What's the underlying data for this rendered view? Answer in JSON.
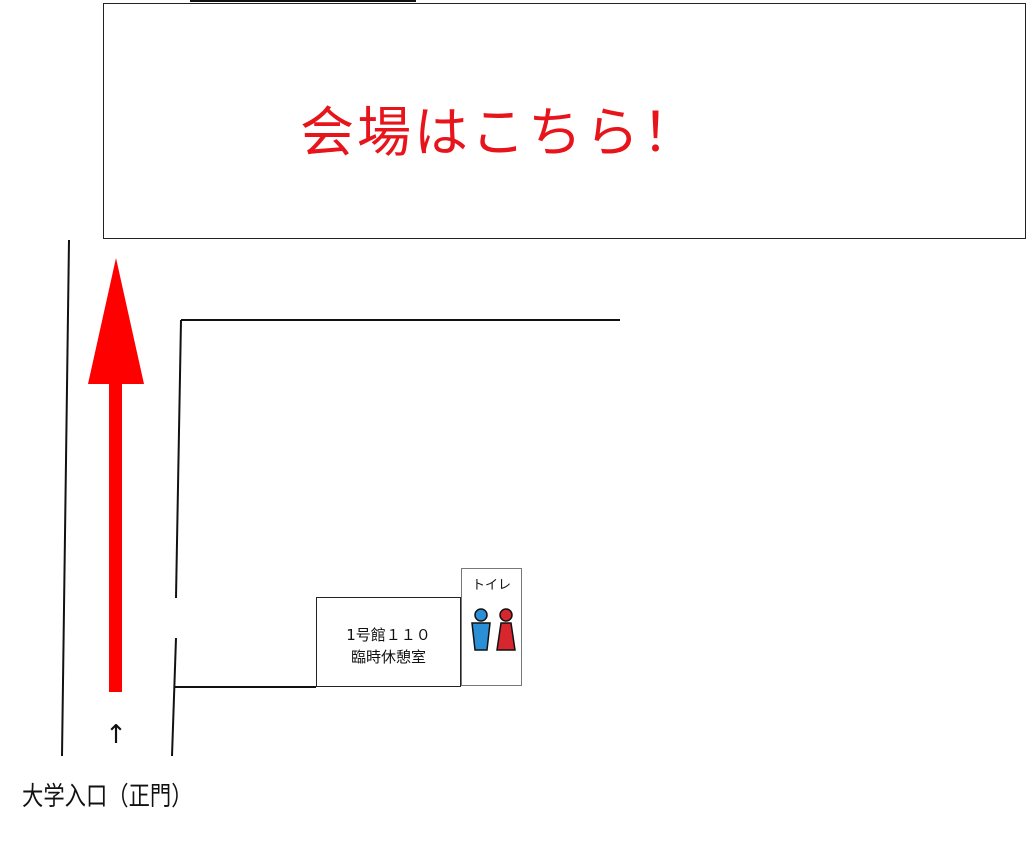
{
  "venue": {
    "label": "会場はこちら！"
  },
  "room": {
    "line1": "1号館１１０",
    "line2": "臨時休憩室"
  },
  "toilet": {
    "label": "トイレ",
    "icon": "restroom-icon"
  },
  "entrance": {
    "arrow": "↑",
    "label": "大学入口（正門）"
  },
  "colors": {
    "accent": "#e8141b",
    "male": "#2b8fd6",
    "female": "#d8262e"
  }
}
